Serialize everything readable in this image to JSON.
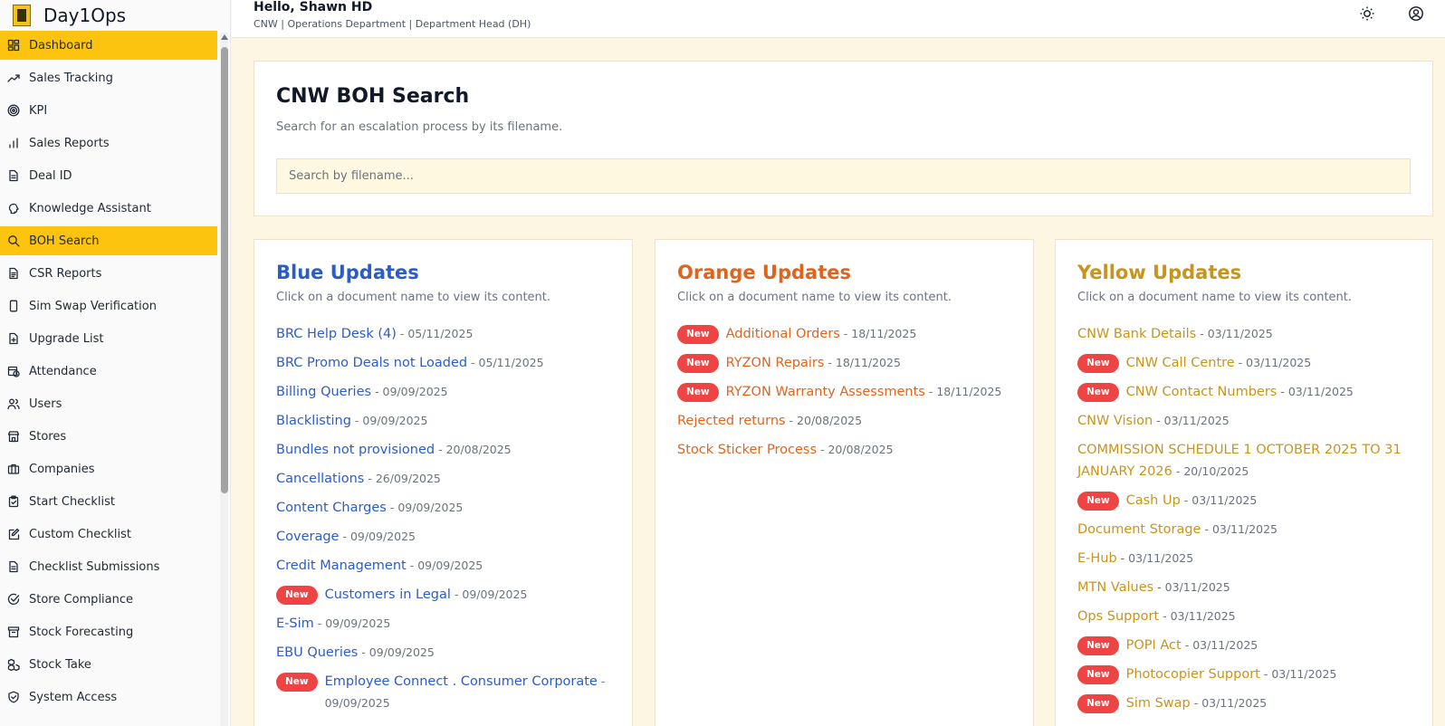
{
  "brand": {
    "name": "Day1Ops"
  },
  "header": {
    "greeting": "Hello, Shawn HD",
    "subline": "CNW | Operations Department | Department Head (DH)"
  },
  "sidebar": {
    "items": [
      {
        "label": "Dashboard",
        "icon": "dashboard-icon",
        "active": true
      },
      {
        "label": "Sales Tracking",
        "icon": "trending-up-icon"
      },
      {
        "label": "KPI",
        "icon": "target-icon"
      },
      {
        "label": "Sales Reports",
        "icon": "bar-chart-icon"
      },
      {
        "label": "Deal ID",
        "icon": "document-icon"
      },
      {
        "label": "Knowledge Assistant",
        "icon": "brain-icon"
      },
      {
        "label": "BOH Search",
        "icon": "search-icon",
        "active": true
      },
      {
        "label": "CSR Reports",
        "icon": "report-icon"
      },
      {
        "label": "Sim Swap Verification",
        "icon": "phone-icon"
      },
      {
        "label": "Upgrade List",
        "icon": "file-plus-icon"
      },
      {
        "label": "Attendance",
        "icon": "calendar-clock-icon"
      },
      {
        "label": "Users",
        "icon": "users-icon"
      },
      {
        "label": "Stores",
        "icon": "store-icon"
      },
      {
        "label": "Companies",
        "icon": "briefcase-icon"
      },
      {
        "label": "Start Checklist",
        "icon": "clipboard-check-icon"
      },
      {
        "label": "Custom Checklist",
        "icon": "edit-icon"
      },
      {
        "label": "Checklist Submissions",
        "icon": "file-list-icon"
      },
      {
        "label": "Store Compliance",
        "icon": "check-circle-icon"
      },
      {
        "label": "Stock Forecasting",
        "icon": "archive-icon"
      },
      {
        "label": "Stock Take",
        "icon": "boxes-icon"
      },
      {
        "label": "System Access",
        "icon": "shield-check-icon"
      }
    ]
  },
  "search": {
    "title": "CNW BOH Search",
    "subtitle": "Search for an escalation process by its filename.",
    "placeholder": "Search by filename..."
  },
  "columns": {
    "blue": {
      "title": "Blue Updates",
      "subtitle": "Click on a document name to view its content.",
      "items": [
        {
          "name": "BRC Help Desk (4)",
          "date": "05/11/2025"
        },
        {
          "name": "BRC Promo Deals not Loaded",
          "date": "05/11/2025"
        },
        {
          "name": "Billing Queries",
          "date": "09/09/2025"
        },
        {
          "name": "Blacklisting",
          "date": "09/09/2025"
        },
        {
          "name": "Bundles not provisioned",
          "date": "20/08/2025"
        },
        {
          "name": "Cancellations",
          "date": "26/09/2025"
        },
        {
          "name": "Content Charges",
          "date": "09/09/2025"
        },
        {
          "name": "Coverage",
          "date": "09/09/2025"
        },
        {
          "name": "Credit Management",
          "date": "09/09/2025"
        },
        {
          "name": "Customers in Legal",
          "date": "09/09/2025",
          "new": true
        },
        {
          "name": "E-Sim",
          "date": "09/09/2025"
        },
        {
          "name": "EBU Queries",
          "date": "09/09/2025"
        },
        {
          "name": "Employee Connect . Consumer Corporate",
          "date": "09/09/2025",
          "new": true
        }
      ]
    },
    "orange": {
      "title": "Orange Updates",
      "subtitle": "Click on a document name to view its content.",
      "items": [
        {
          "name": "Additional Orders",
          "date": "18/11/2025",
          "new": true
        },
        {
          "name": "RYZON Repairs",
          "date": "18/11/2025",
          "new": true
        },
        {
          "name": "RYZON Warranty Assessments",
          "date": "18/11/2025",
          "new": true
        },
        {
          "name": "Rejected returns",
          "date": "20/08/2025"
        },
        {
          "name": "Stock Sticker Process",
          "date": "20/08/2025"
        }
      ]
    },
    "yellow": {
      "title": "Yellow Updates",
      "subtitle": "Click on a document name to view its content.",
      "items": [
        {
          "name": "CNW Bank Details",
          "date": "03/11/2025"
        },
        {
          "name": "CNW Call Centre",
          "date": "03/11/2025",
          "new": true
        },
        {
          "name": "CNW Contact Numbers",
          "date": "03/11/2025",
          "new": true
        },
        {
          "name": "CNW Vision",
          "date": "03/11/2025"
        },
        {
          "name": "COMMISSION SCHEDULE 1 OCTOBER 2025 TO 31 JANUARY 2026",
          "date": "20/10/2025"
        },
        {
          "name": "Cash Up",
          "date": "03/11/2025",
          "new": true
        },
        {
          "name": "Document Storage",
          "date": "03/11/2025"
        },
        {
          "name": "E-Hub",
          "date": "03/11/2025"
        },
        {
          "name": "MTN Values",
          "date": "03/11/2025"
        },
        {
          "name": "Ops Support",
          "date": "03/11/2025"
        },
        {
          "name": "POPI Act",
          "date": "03/11/2025",
          "new": true
        },
        {
          "name": "Photocopier Support",
          "date": "03/11/2025",
          "new": true
        },
        {
          "name": "Sim Swap",
          "date": "03/11/2025",
          "new": true
        }
      ]
    }
  },
  "badge_label": "New",
  "date_separator": " - ",
  "colors": {
    "accent": "#fdc40f",
    "blue": "#2b5cc8",
    "orange": "#e0641e",
    "yellow": "#c8941a",
    "badge": "#ef4444"
  }
}
